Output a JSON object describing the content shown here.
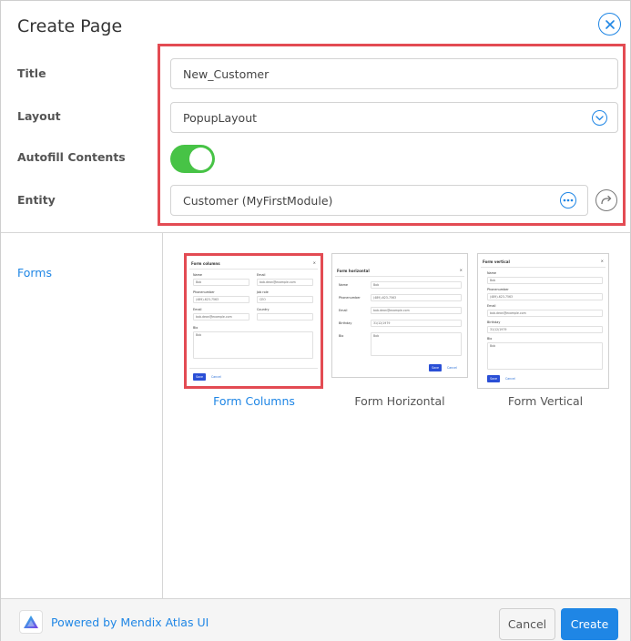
{
  "dialog": {
    "title": "Create Page",
    "close_icon": "close-circle-icon"
  },
  "form": {
    "title_label": "Title",
    "title_value": "New_Customer",
    "layout_label": "Layout",
    "layout_value": "PopupLayout",
    "autofill_label": "Autofill Contents",
    "autofill_on": true,
    "entity_label": "Entity",
    "entity_value": "Customer (MyFirstModule)"
  },
  "nav": {
    "items": [
      {
        "label": "Forms",
        "active": true
      }
    ]
  },
  "templates": [
    {
      "label": "Form Columns",
      "selected": true,
      "preview": {
        "heading": "Form columns",
        "name_label": "Name",
        "name_value": "Bob",
        "email_label": "Email",
        "email_value": "bob.dean@example.com",
        "phone_label": "Phonenumber",
        "phone_value": "(489)-623-7563",
        "jobrole_label": "Job role",
        "jobrole_value": "CEO",
        "email2_label": "Email",
        "email2_value": "bob.dean@example.com",
        "country_label": "Country",
        "bio_label": "Bio",
        "bio_value": "Bob",
        "save": "Save",
        "cancel": "Cancel"
      }
    },
    {
      "label": "Form Horizontal",
      "selected": false,
      "preview": {
        "heading": "Form horizontal",
        "name_label": "Name",
        "name_value": "Bob",
        "phone_label": "Phonenumber",
        "phone_value": "(489)-623-7563",
        "email_label": "Email",
        "email_value": "bob.dean@example.com",
        "birthday_label": "Birthday",
        "birthday_value": "31/12/1979",
        "bio_label": "Bio",
        "bio_value": "Bob",
        "save": "Save",
        "cancel": "Cancel"
      }
    },
    {
      "label": "Form Vertical",
      "selected": false,
      "preview": {
        "heading": "Form vertical",
        "name_label": "Name",
        "name_value": "Bob",
        "phone_label": "Phonenumber",
        "phone_value": "(489)-623-7563",
        "email_label": "Email",
        "email_value": "bob.dean@example.com",
        "birthday_label": "Birthday",
        "birthday_value": "31/12/1979",
        "bio_label": "Bio",
        "bio_value": "Bob",
        "save": "Save",
        "cancel": "Cancel"
      }
    }
  ],
  "footer": {
    "powered_by": "Powered by Mendix Atlas UI",
    "cancel_label": "Cancel",
    "create_label": "Create"
  },
  "colors": {
    "accent": "#1f86e5",
    "toggle_on": "#47c346",
    "highlight": "#e34b53"
  }
}
